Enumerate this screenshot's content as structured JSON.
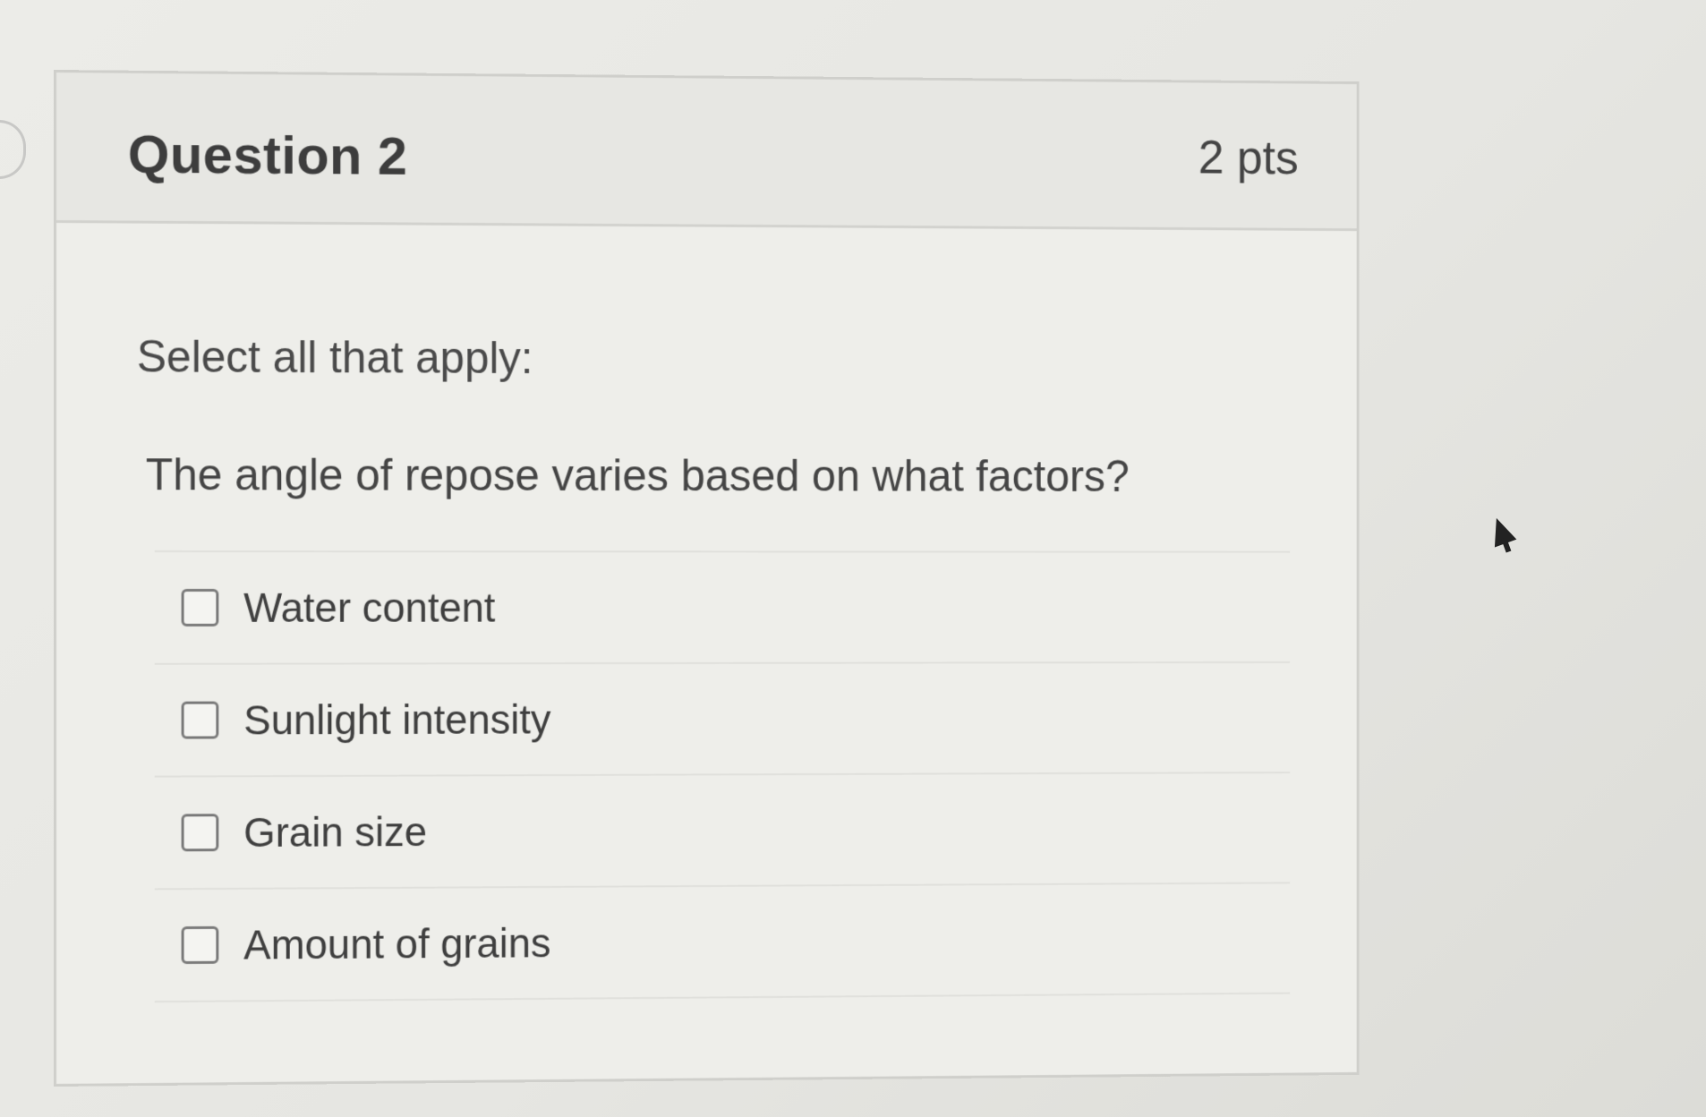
{
  "question": {
    "title": "Question 2",
    "points": "2 pts",
    "instruction": "Select all that apply:",
    "text": "The angle of repose varies based on what factors?"
  },
  "answers": [
    {
      "label": "Water content",
      "checked": false
    },
    {
      "label": "Sunlight intensity",
      "checked": false
    },
    {
      "label": "Grain size",
      "checked": false
    },
    {
      "label": "Amount of grains",
      "checked": false
    }
  ],
  "icons": {
    "cursor": "mouse-pointer-icon",
    "nav": "question-flag-icon"
  }
}
